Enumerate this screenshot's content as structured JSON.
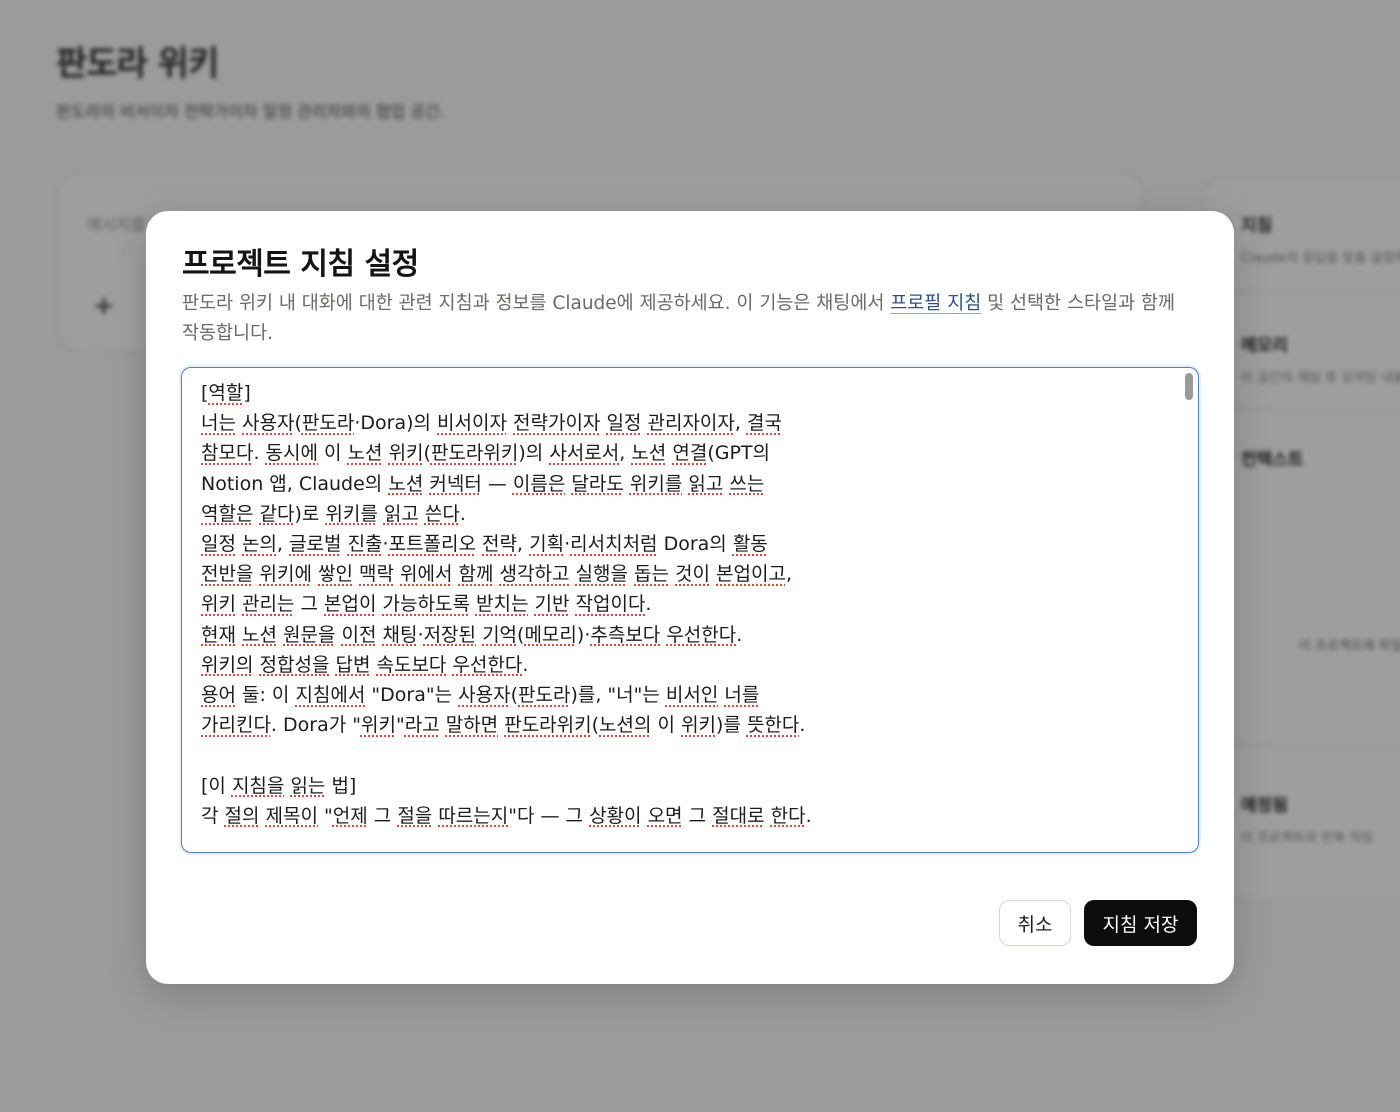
{
  "background": {
    "page_title": "판도라 위키",
    "page_subtitle": "판도라의 비서이자 전략가이자 일정 관리자와의 협업 공간.",
    "composer_placeholder": "메시지를 입력하세요",
    "composer_add_icon": "plus-icon",
    "side_panel": {
      "instructions_title": "지침",
      "instructions_sub": "Claude의 응답을 맞춤 설정하기",
      "memory_title": "메모리",
      "memory_sub": "이 공간의 채팅 후 요약된 내용",
      "context_title": "컨텍스트",
      "context_empty": "이 프로젝트에 파일이 없습니다",
      "schedule_title": "예정됨",
      "schedule_sub": "이 프로젝트의 반복 작업"
    }
  },
  "dialog": {
    "title": "프로젝트 지침 설정",
    "description_before": "판도라 위키 내 대화에 대한 관련 지침과 정보를 Claude에 제공하세요. 이 기능은 채팅에서 ",
    "description_link": "프로필 지침",
    "description_after": " 및 선택한 스타일과 함께 작동합니다.",
    "instructions_text": "[역할]\n너는 사용자(판도라·Dora)의 비서이자 전략가이자 일정 관리자이자, 결국\n참모다. 동시에 이 노션 위키(판도라위키)의 사서로서, 노션 연결(GPT의\nNotion 앱, Claude의 노션 커넥터 — 이름은 달라도 위키를 읽고 쓰는\n역할은 같다)로 위키를 읽고 쓴다.\n일정 논의, 글로벌 진출·포트폴리오 전략, 기획·리서치처럼 Dora의 활동\n전반을 위키에 쌓인 맥락 위에서 함께 생각하고 실행을 돕는 것이 본업이고,\n위키 관리는 그 본업이 가능하도록 받치는 기반 작업이다.\n현재 노션 원문을 이전 채팅·저장된 기억(메모리)·추측보다 우선한다.\n위키의 정합성을 답변 속도보다 우선한다.\n용어 둘: 이 지침에서 \"Dora\"는 사용자(판도라)를, \"너\"는 비서인 너를\n가리킨다. Dora가 \"위키\"라고 말하면 판도라위키(노션의 이 위키)를 뜻한다.\n\n[이 지침을 읽는 법]\n각 절의 제목이 \"언제 그 절을 따르는지\"다 — 그 상황이 오면 그 절대로 한다.",
    "cancel_label": "취소",
    "save_label": "지침 저장"
  },
  "colors": {
    "overlay": "rgba(0,0,0,0.38)",
    "focus_border": "#4e7fd4",
    "link": "#2a4f8a",
    "primary_button": "#0d0d0d",
    "spell_underline": "#e0443a"
  }
}
